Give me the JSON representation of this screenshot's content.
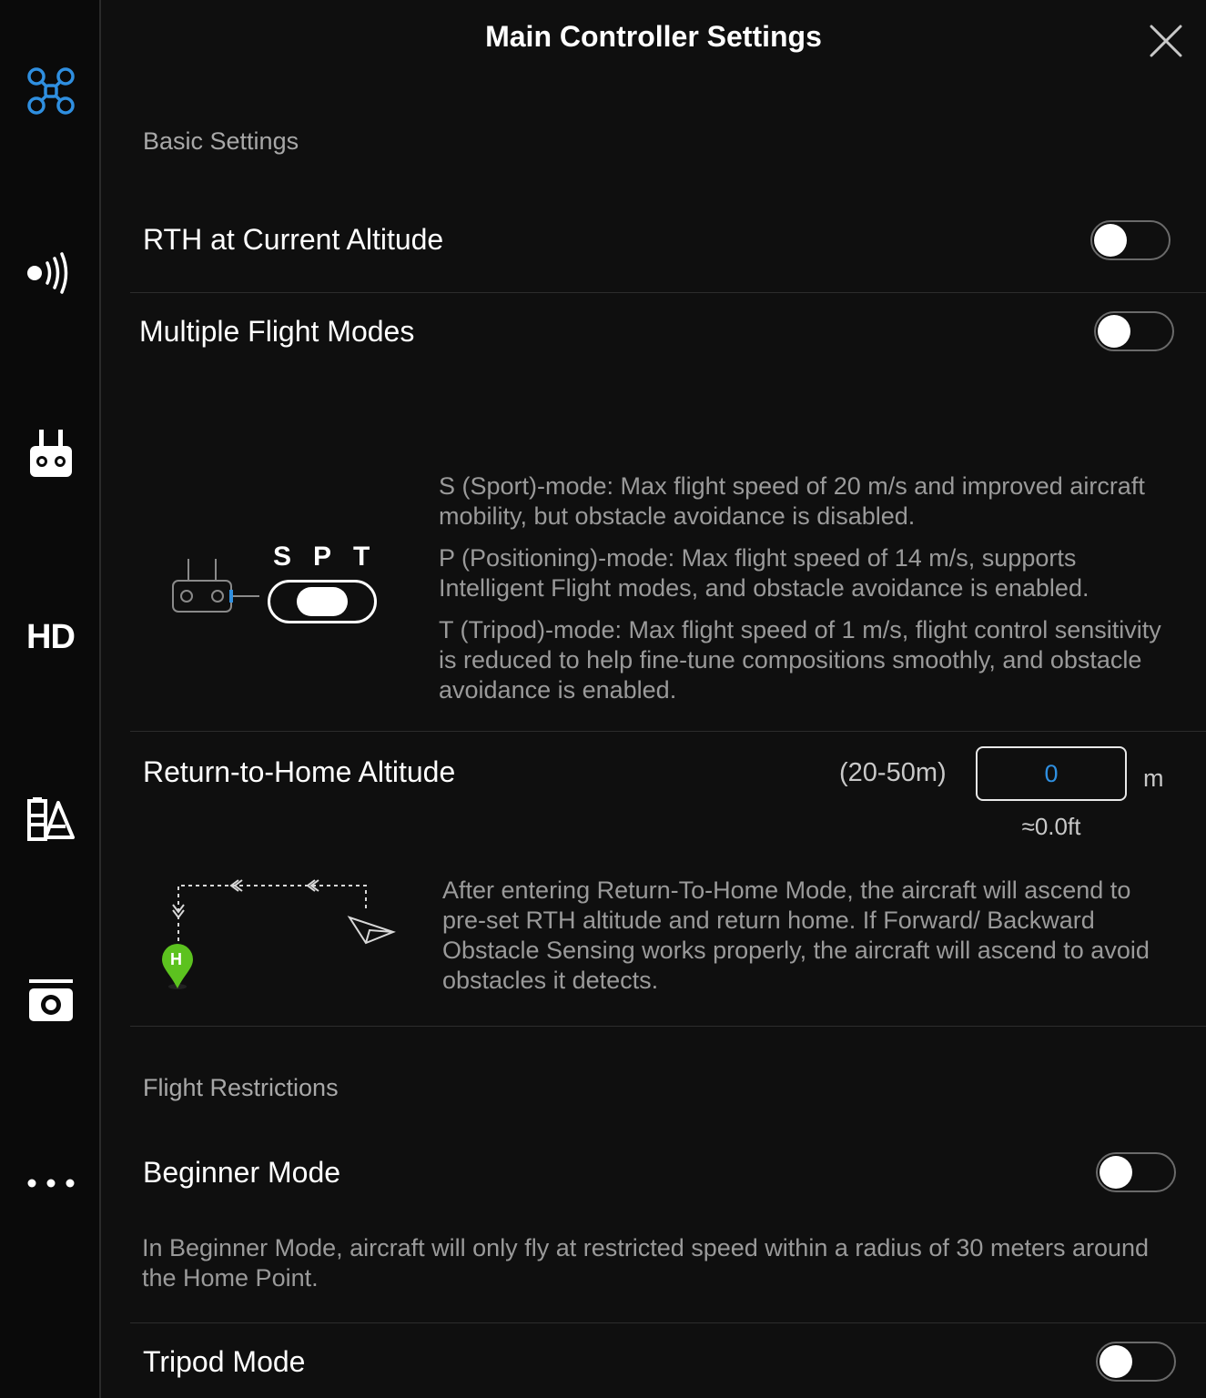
{
  "header": {
    "title": "Main Controller Settings"
  },
  "sidebar": {
    "items": [
      {
        "name": "aircraft"
      },
      {
        "name": "sensors"
      },
      {
        "name": "remote-controller"
      },
      {
        "label": "HD"
      },
      {
        "name": "battery"
      },
      {
        "name": "gimbal-camera"
      },
      {
        "name": "more"
      }
    ]
  },
  "basic": {
    "section_label": "Basic Settings",
    "rth_current_altitude": {
      "label": "RTH at Current Altitude",
      "enabled": false
    },
    "multiple_flight_modes": {
      "label": "Multiple Flight Modes",
      "enabled": false
    },
    "mode_switch": {
      "s": "S",
      "p": "P",
      "t": "T"
    },
    "mode_descriptions": [
      "S (Sport)-mode: Max flight speed of 20 m/s and improved aircraft mobility, but obstacle avoidance is disabled.",
      "P (Positioning)-mode: Max flight speed of 14 m/s, supports Intelligent Flight modes, and obstacle avoidance is enabled.",
      "T (Tripod)-mode: Max flight speed of 1 m/s, flight control sensitivity is reduced to help fine-tune compositions smoothly, and obstacle avoidance is enabled."
    ],
    "rth_altitude": {
      "label": "Return-to-Home Altitude",
      "range": "(20-50m)",
      "value": "0",
      "unit": "m",
      "conversion": "≈0.0ft",
      "home_marker": "H",
      "description": "After entering Return-To-Home Mode, the aircraft will ascend to pre-set RTH altitude and return home. If Forward/ Backward Obstacle Sensing works properly, the aircraft will ascend to avoid obstacles it detects."
    }
  },
  "restrictions": {
    "section_label": "Flight Restrictions",
    "beginner_mode": {
      "label": "Beginner Mode",
      "enabled": false,
      "description": "In Beginner Mode, aircraft will only fly at restricted speed within a radius of 30 meters around the Home Point."
    },
    "tripod_mode": {
      "label": "Tripod Mode",
      "enabled": false
    }
  },
  "colors": {
    "accent": "#2f8fe0",
    "home_marker": "#5cc21f",
    "background": "#0f0f0f"
  }
}
